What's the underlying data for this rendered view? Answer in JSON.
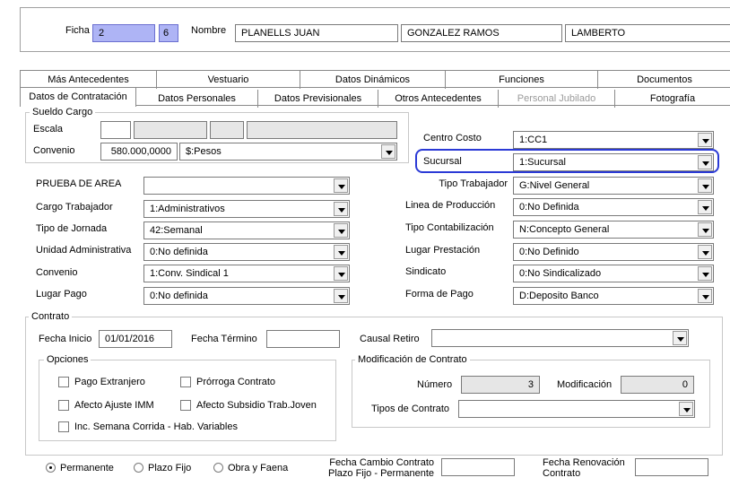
{
  "header": {
    "ficha_label": "Ficha",
    "ficha_value": "2",
    "ficha_dv": "6",
    "nombre_label": "Nombre",
    "nombres": "PLANELLS JUAN",
    "apellido_paterno": "GONZALEZ RAMOS",
    "apellido_materno": "LAMBERTO"
  },
  "tabs_row1": [
    "Más Antecedentes",
    "Vestuario",
    "Datos Dinámicos",
    "Funciones",
    "Documentos"
  ],
  "tabs_row2": [
    "Datos de Contratación",
    "Datos Personales",
    "Datos Previsionales",
    "Otros Antecedentes",
    "Personal Jubilado",
    "Fotografía"
  ],
  "sueldo": {
    "title": "Sueldo Cargo",
    "escala_label": "Escala",
    "convenio_label": "Convenio",
    "convenio_value": "580.000,0000",
    "moneda": "$:Pesos"
  },
  "centro_costo": {
    "label": "Centro Costo",
    "value": "1:CC1"
  },
  "sucursal": {
    "label": "Sucursal",
    "value": "1:Sucursal"
  },
  "left_fields": [
    {
      "label": "PRUEBA DE AREA",
      "value": ""
    },
    {
      "label": "Cargo Trabajador",
      "value": "1:Administrativos"
    },
    {
      "label": "Tipo de Jornada",
      "value": "42:Semanal"
    },
    {
      "label": "Unidad Administrativa",
      "value": "0:No definida"
    },
    {
      "label": "Convenio",
      "value": "1:Conv. Sindical 1"
    },
    {
      "label": "Lugar Pago",
      "value": "0:No definida"
    }
  ],
  "right_fields": [
    {
      "label": "Tipo Trabajador",
      "value": "G:Nivel General"
    },
    {
      "label": "Linea de Producción",
      "value": "0:No Definida"
    },
    {
      "label": "Tipo Contabilización",
      "value": "N:Concepto General"
    },
    {
      "label": "Lugar Prestación",
      "value": "0:No Definido"
    },
    {
      "label": "Sindicato",
      "value": "0:No Sindicalizado"
    },
    {
      "label": "Forma de Pago",
      "value": "D:Deposito Banco"
    }
  ],
  "contrato": {
    "title": "Contrato",
    "fecha_inicio_label": "Fecha Inicio",
    "fecha_inicio": "01/01/2016",
    "fecha_termino_label": "Fecha Término",
    "fecha_termino": "",
    "causal_label": "Causal Retiro",
    "causal_value": ""
  },
  "opciones": {
    "title": "Opciones",
    "pago_extranjero": "Pago Extranjero",
    "prorroga": "Prórroga Contrato",
    "afecto_imm": "Afecto Ajuste IMM",
    "afecto_subsidio": "Afecto Subsidio Trab.Joven",
    "semana_corrida": "Inc. Semana Corrida - Hab. Variables"
  },
  "modificacion": {
    "title": "Modificación de Contrato",
    "numero_label": "Número",
    "numero_value": "3",
    "modif_label": "Modificación",
    "modif_value": "0",
    "tipos_label": "Tipos de Contrato",
    "tipos_value": ""
  },
  "radios": {
    "permanente": "Permanente",
    "plazo_fijo": "Plazo Fijo",
    "obra_faena": "Obra y Faena"
  },
  "fecha_cambio": {
    "line1": "Fecha Cambio Contrato",
    "line2": "Plazo Fijo - Permanente",
    "value": ""
  },
  "fecha_renovacion": {
    "line1": "Fecha Renovación",
    "line2": "Contrato",
    "value": ""
  },
  "colors": {
    "highlight": "#2b3ad6",
    "ficha_bg": "#aeb4f5"
  }
}
